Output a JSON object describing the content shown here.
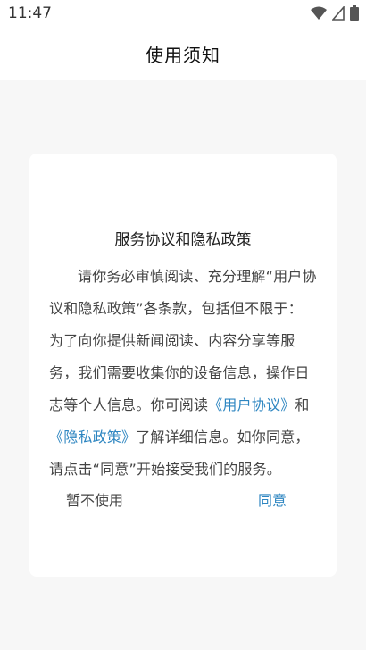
{
  "status_bar": {
    "time": "11:47",
    "icons": [
      "wifi-icon",
      "signal-icon",
      "battery-icon"
    ]
  },
  "header": {
    "title": "使用须知"
  },
  "dialog": {
    "title": "服务协议和隐私政策",
    "body_part1": "请你务必审慎阅读、充分理解“用户协议和隐私政策”各条款，包括但不限于：为了向你提供新闻阅读、内容分享等服务，我们需要收集你的设备信息，操作日志等个人信息。你可阅读",
    "user_agreement_link": "《用户协议》",
    "body_and": "和",
    "privacy_policy_link": "《隐私政策》",
    "body_part2": "了解详细信息。如你同意，请点击“同意”开始接受我们的服务。",
    "decline_label": "暂不使用",
    "agree_label": "同意"
  },
  "colors": {
    "link": "#2e86c1",
    "background": "#f7f7f7",
    "card": "#ffffff"
  }
}
